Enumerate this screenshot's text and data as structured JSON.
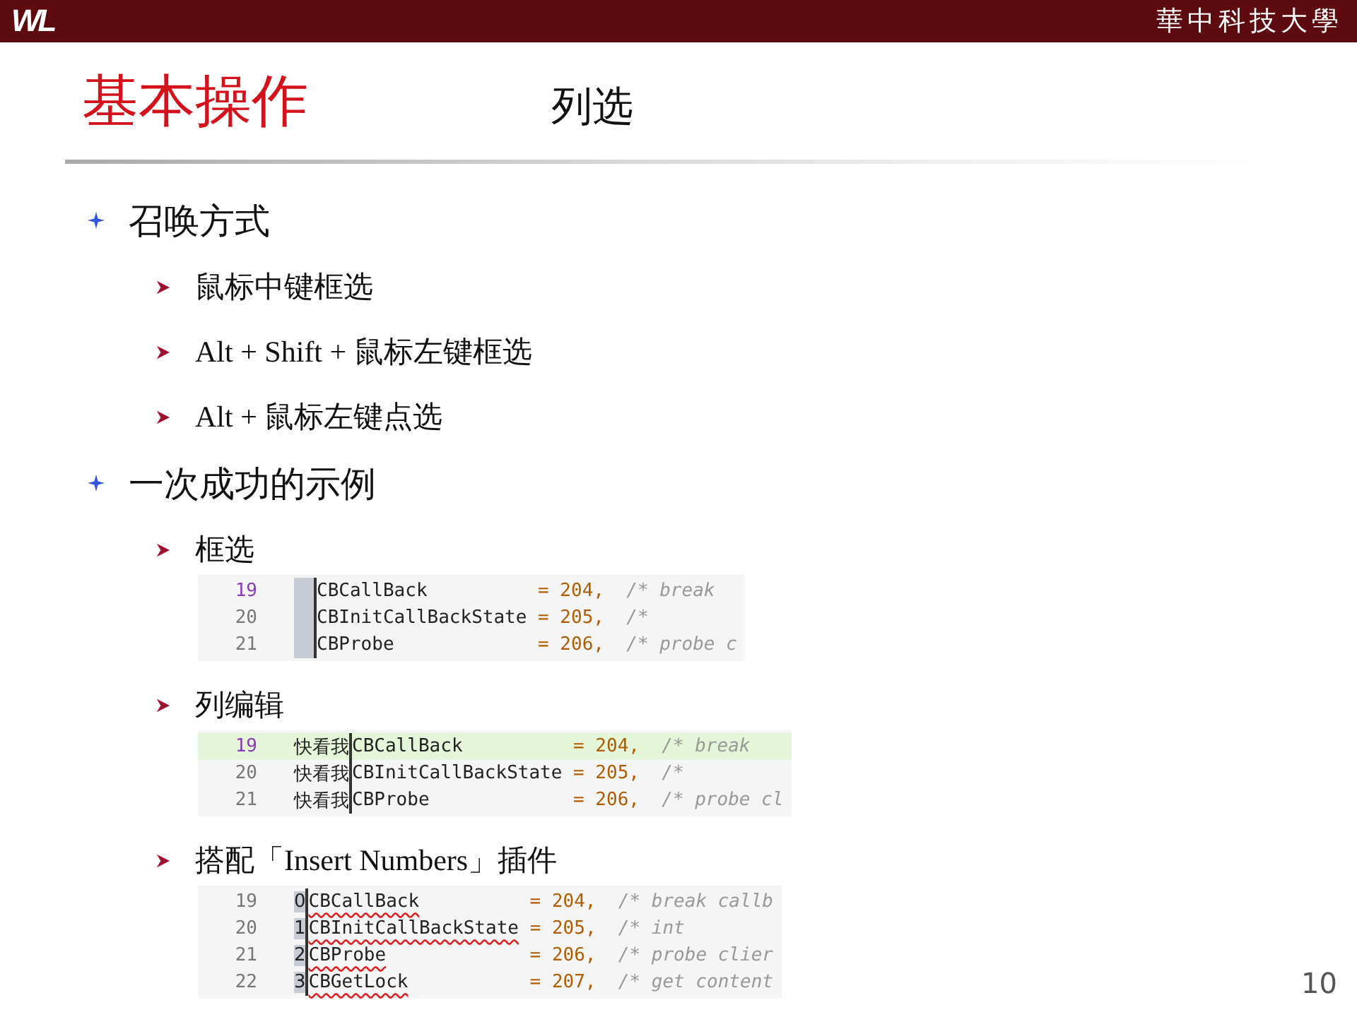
{
  "header": {
    "logo": "WL",
    "university": "華中科技大學"
  },
  "title": "基本操作",
  "subtitle": "列选",
  "sections": [
    {
      "text": "召唤方式",
      "items": [
        {
          "text": "鼠标中键框选"
        },
        {
          "text": "Alt + Shift + 鼠标左键框选"
        },
        {
          "text": "Alt + 鼠标左键点选"
        }
      ]
    },
    {
      "text": "一次成功的示例",
      "items": [
        {
          "text": "框选",
          "code": {
            "block_selection": true,
            "lines": [
              {
                "number": "19",
                "name": "CBCallBack",
                "value": "= 204,",
                "comment": "/* break",
                "current": true,
                "squiggle": false
              },
              {
                "number": "20",
                "name": "CBInitCallBackState",
                "value": "= 205,",
                "comment": "/*",
                "current": false,
                "squiggle": false
              },
              {
                "number": "21",
                "name": "CBProbe",
                "value": "= 206,",
                "comment": "/* probe c",
                "current": false,
                "squiggle": false
              }
            ]
          }
        },
        {
          "text": "列编辑",
          "code": {
            "block_selection": false,
            "lines": [
              {
                "number": "19",
                "prefix": "快看我",
                "name": "CBCallBack",
                "value": "= 204,",
                "comment": "/* break",
                "current": true,
                "squiggle": false
              },
              {
                "number": "20",
                "prefix": "快看我",
                "name": "CBInitCallBackState",
                "value": "= 205,",
                "comment": "/*",
                "current": false,
                "squiggle": false
              },
              {
                "number": "21",
                "prefix": "快看我",
                "name": "CBProbe",
                "value": "= 206,",
                "comment": "/* probe cl",
                "current": false,
                "squiggle": false
              }
            ]
          }
        },
        {
          "text": "搭配「Insert Numbers」插件",
          "code": {
            "block_selection": true,
            "lines": [
              {
                "number": "19",
                "prefix": "0",
                "name": "CBCallBack",
                "value": "= 204,",
                "comment": "/* break callb",
                "current": false,
                "squiggle": true
              },
              {
                "number": "20",
                "prefix": "1",
                "name": "CBInitCallBackState",
                "value": "= 205,",
                "comment": "/* int",
                "current": false,
                "squiggle": true
              },
              {
                "number": "21",
                "prefix": "2",
                "name": "CBProbe",
                "value": "= 206,",
                "comment": "/* probe clier",
                "current": false,
                "squiggle": true
              },
              {
                "number": "22",
                "prefix": "3",
                "name": "CBGetLock",
                "value": "= 207,",
                "comment": "/* get content",
                "current": false,
                "squiggle": true
              }
            ]
          }
        }
      ]
    }
  ],
  "page_number": "10"
}
